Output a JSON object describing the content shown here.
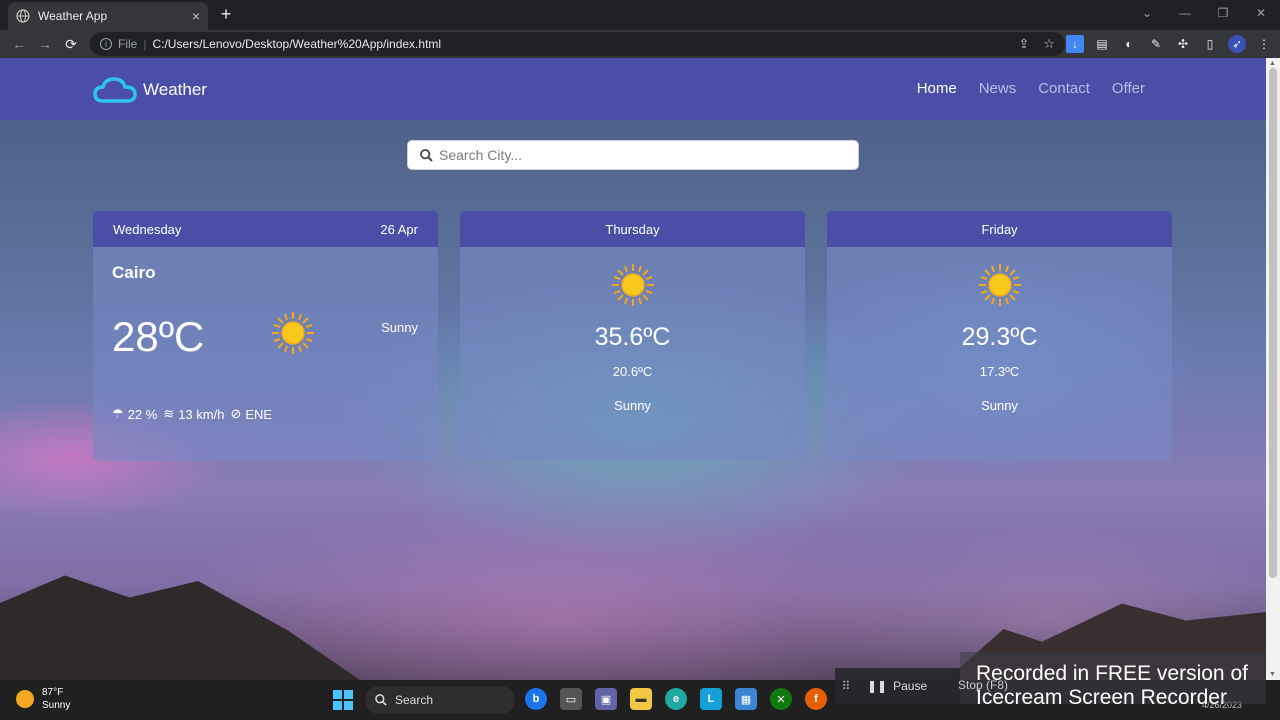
{
  "browser": {
    "tab_title": "Weather App",
    "tab_close": "×",
    "new_tab": "+",
    "url_prefix": "File",
    "url_separator": "|",
    "url": "C:/Users/Lenovo/Desktop/Weather%20App/index.html",
    "window_controls": [
      "⌄",
      "—",
      "❐",
      "✕"
    ]
  },
  "navbar": {
    "brand": "Weather",
    "links": [
      {
        "label": "Home",
        "active": true
      },
      {
        "label": "News",
        "active": false
      },
      {
        "label": "Contact",
        "active": false
      },
      {
        "label": "Offer",
        "active": false
      }
    ]
  },
  "search": {
    "placeholder": "Search City...",
    "icon": "search-icon"
  },
  "today": {
    "day": "Wednesday",
    "date": "26 Apr",
    "city": "Cairo",
    "temp": "28ºC",
    "condition": "Sunny",
    "humidity": "22 %",
    "wind": "13 km/h",
    "direction": "ENE"
  },
  "forecast": [
    {
      "day": "Thursday",
      "max": "35.6ºC",
      "min": "20.6ºC",
      "condition": "Sunny"
    },
    {
      "day": "Friday",
      "max": "29.3ºC",
      "min": "17.3ºC",
      "condition": "Sunny"
    }
  ],
  "colors": {
    "navbar": "#4a4ea6",
    "card_header": "#4a4ea6",
    "sun": "#f9c81d"
  },
  "recorder": {
    "pause_label": "Pause",
    "stop_label": "Stop (F8)",
    "watermark_line1": "Recorded in FREE version of",
    "watermark_line2": "Icecream   Screen   Recorder"
  },
  "taskbar": {
    "weather_temp": "87°F",
    "weather_condition": "Sunny",
    "search_label": "Search",
    "date": "4/26/2023"
  }
}
